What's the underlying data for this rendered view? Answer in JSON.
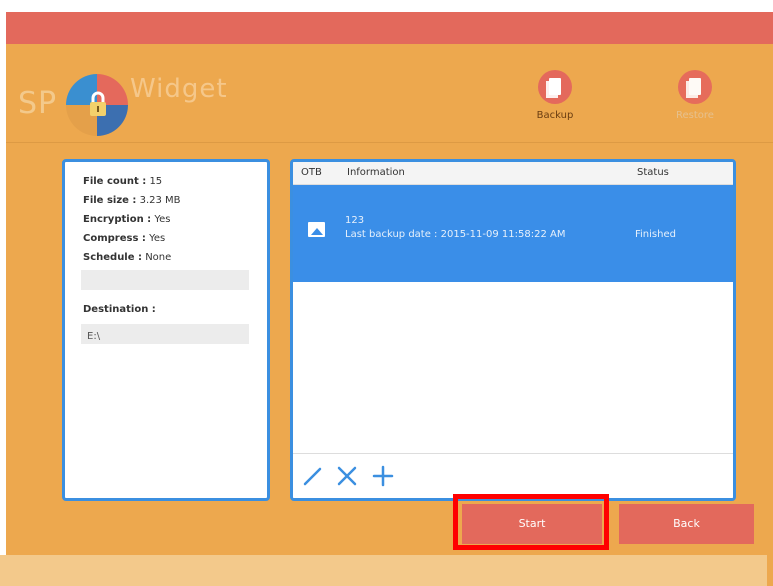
{
  "app": {
    "logo_sp": "SP",
    "logo_widget": "Widget"
  },
  "toolbar": {
    "backup_label": "Backup",
    "restore_label": "Restore"
  },
  "info": {
    "file_count_label": "File count :",
    "file_count_value": "15",
    "file_size_label": "File size :",
    "file_size_value": "3.23 MB",
    "encryption_label": "Encryption :",
    "encryption_value": "Yes",
    "compress_label": "Compress :",
    "compress_value": "Yes",
    "schedule_label": "Schedule :",
    "schedule_value": "None",
    "destination_label": "Destination :",
    "destination_value": "E:\\"
  },
  "list": {
    "columns": [
      "OTB",
      "Information",
      "Status"
    ],
    "rows": [
      {
        "name": "123",
        "last_backup": "Last backup date : 2015-11-09 11:58:22 AM",
        "status": "Finished"
      }
    ]
  },
  "buttons": {
    "start": "Start",
    "back": "Back"
  },
  "colors": {
    "frame": "#eda84e",
    "titlebar": "#e3695c",
    "accent_blue": "#3b8fe0",
    "button_red": "#e3695c",
    "highlight": "#ff0000"
  }
}
